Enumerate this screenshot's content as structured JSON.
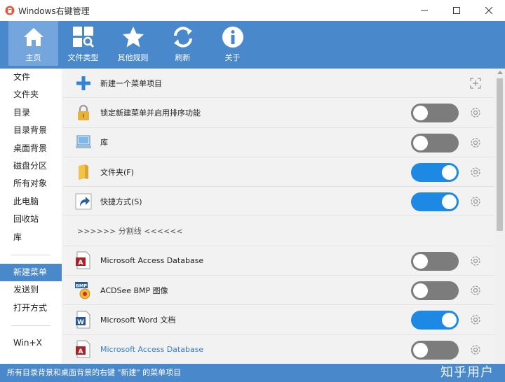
{
  "window": {
    "title": "Windows右键管理"
  },
  "toolbar": [
    {
      "label": "主页",
      "icon": "home-icon",
      "active": true
    },
    {
      "label": "文件类型",
      "icon": "file-types-icon"
    },
    {
      "label": "其他规则",
      "icon": "star-icon"
    },
    {
      "label": "刷新",
      "icon": "refresh-icon"
    },
    {
      "label": "关于",
      "icon": "info-icon"
    }
  ],
  "sidebar": {
    "group1": [
      "文件",
      "文件夹",
      "目录",
      "目录背景",
      "桌面背景",
      "磁盘分区",
      "所有对象",
      "此电脑",
      "回收站",
      "库"
    ],
    "group2": [
      "新建菜单",
      "发送到",
      "打开方式"
    ],
    "group3": [
      "Win+X"
    ],
    "active": "新建菜单"
  },
  "rows": [
    {
      "label": "新建一个菜单项目",
      "icon": "plus-icon",
      "kind": "new"
    },
    {
      "label": "锁定新建菜单并启用排序功能",
      "icon": "lock-icon",
      "toggle": false
    },
    {
      "label": "库",
      "icon": "library-icon",
      "toggle": false
    },
    {
      "label": "文件夹(F)",
      "icon": "folder-icon",
      "toggle": true
    },
    {
      "label": "快捷方式(S)",
      "icon": "shortcut-icon",
      "toggle": true
    },
    {
      "label": ">>>>>> 分割线 <<<<<<",
      "kind": "separator"
    },
    {
      "label": "Microsoft Access Database",
      "icon": "access-icon",
      "toggle": false
    },
    {
      "label": "ACDSee BMP 图像",
      "icon": "bmp-icon",
      "toggle": false
    },
    {
      "label": "Microsoft Word 文档",
      "icon": "word-icon",
      "toggle": true
    },
    {
      "label": "Microsoft Access Database",
      "icon": "access-icon",
      "toggle": false,
      "highlight": true
    }
  ],
  "status": {
    "text": "所有目录背景和桌面背景的右键 \"新建\" 的菜单项目",
    "watermark": "知乎用户"
  },
  "colors": {
    "accent": "#4a88cc",
    "toggle_on": "#1e88e5",
    "toggle_off": "#7c7c7c"
  }
}
